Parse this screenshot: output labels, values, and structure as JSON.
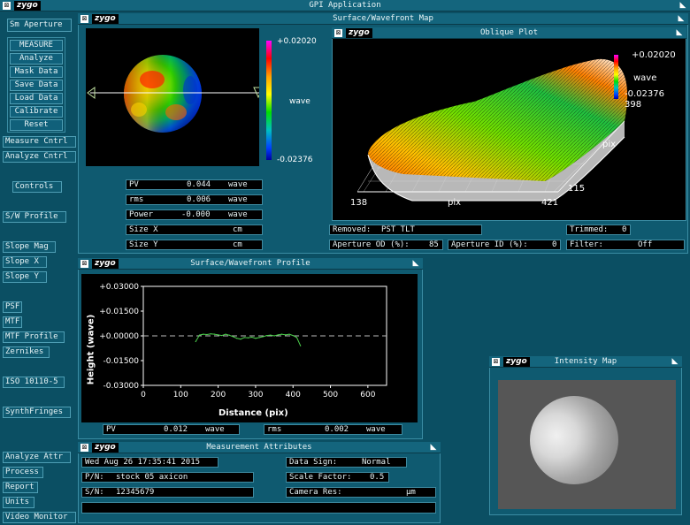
{
  "app": {
    "title": "GPI Application",
    "logo": "zygo"
  },
  "left_menu": {
    "sm_aperture": "Sm Aperture",
    "actions": [
      "MEASURE",
      "Analyze",
      "Mask Data",
      "Save Data",
      "Load Data",
      "Calibrate",
      "Reset"
    ],
    "measure_cntrl": "Measure Cntrl",
    "analyze_cntrl": "Analyze Cntrl",
    "controls": "Controls",
    "sw_profile": "S/W Profile",
    "slope_mag": "Slope Mag",
    "slope_x": "Slope X",
    "slope_y": "Slope Y",
    "psf": "PSF",
    "mtf": "MTF",
    "mtf_profile": "MTF Profile",
    "zernikes": "Zernikes",
    "iso": "ISO 10110-5",
    "synth": "SynthFringes",
    "analyze_attr": "Analyze Attr",
    "process": "Process",
    "report": "Report",
    "units": "Units",
    "video_monitor": "Video Monitor"
  },
  "surface_map": {
    "title": "Surface/Wavefront Map",
    "scale_max": "+0.02020",
    "scale_unit": "wave",
    "scale_min": "-0.02376",
    "stats": {
      "pv": {
        "label": "PV",
        "value": "0.044",
        "unit": "wave"
      },
      "rms": {
        "label": "rms",
        "value": "0.006",
        "unit": "wave"
      },
      "power": {
        "label": "Power",
        "value": "-0.000",
        "unit": "wave"
      },
      "size_x": {
        "label": "Size X",
        "value": "",
        "unit": "cm"
      },
      "size_y": {
        "label": "Size Y",
        "value": "",
        "unit": "cm"
      }
    }
  },
  "oblique": {
    "title": "Oblique Plot",
    "scale_max": "+0.02020",
    "scale_unit": "wave",
    "scale_min": "-0.02376",
    "y_top": "398",
    "y_label": "pix",
    "y_bottom": "115",
    "x_left": "138",
    "x_label": "pix",
    "x_right": "421"
  },
  "info": {
    "removed_label": "Removed:",
    "removed_value": "PST TLT",
    "trimmed_label": "Trimmed:",
    "trimmed_value": "0",
    "aperture_od_label": "Aperture OD (%):",
    "aperture_od_value": "85",
    "aperture_id_label": "Aperture ID (%):",
    "aperture_id_value": "0",
    "filter_label": "Filter:",
    "filter_value": "Off"
  },
  "profile": {
    "title": "Surface/Wavefront Profile",
    "ylabel": "Height (wave)",
    "xlabel": "Distance (pix)",
    "y_ticks": [
      "+0.03000",
      "+0.01500",
      "+0.00000",
      "-0.01500",
      "-0.03000"
    ],
    "x_ticks": [
      "0",
      "100",
      "200",
      "300",
      "400",
      "500",
      "600"
    ],
    "pv": {
      "label": "PV",
      "value": "0.012",
      "unit": "wave"
    },
    "rms": {
      "label": "rms",
      "value": "0.002",
      "unit": "wave"
    }
  },
  "chart_data": {
    "type": "line",
    "title": "Surface/Wavefront Profile",
    "xlabel": "Distance (pix)",
    "ylabel": "Height (wave)",
    "xlim": [
      0,
      650
    ],
    "ylim": [
      -0.03,
      0.03
    ],
    "x": [
      140,
      150,
      160,
      170,
      180,
      190,
      200,
      210,
      220,
      230,
      240,
      250,
      260,
      270,
      280,
      290,
      300,
      310,
      320,
      330,
      340,
      350,
      360,
      370,
      380,
      390,
      400,
      410,
      420
    ],
    "values": [
      -0.0035,
      0.0005,
      0.001,
      0.0008,
      0.0012,
      0.001,
      0.0006,
      0.0002,
      0.001,
      0.0004,
      -0.0005,
      -0.0015,
      -0.002,
      -0.001,
      -0.0012,
      -0.0008,
      -0.0015,
      -0.001,
      -0.0005,
      0.0002,
      0.0005,
      0.0,
      0.0006,
      0.001,
      0.0006,
      0.001,
      0.0002,
      -0.001,
      -0.006
    ]
  },
  "attributes": {
    "title": "Measurement Attributes",
    "date": "Wed Aug 26 17:35:41 2015",
    "pn_label": "P/N:",
    "pn_value": "stock 05 axicon",
    "sn_label": "S/N:",
    "sn_value": "12345679",
    "data_sign_label": "Data Sign:",
    "data_sign_value": "Normal",
    "scale_factor_label": "Scale Factor:",
    "scale_factor_value": "0.5",
    "camera_res_label": "Camera Res:",
    "camera_res_value": "",
    "camera_res_unit": "µm"
  },
  "intensity": {
    "title": "Intensity Map"
  },
  "colors": {
    "background": "#0b4f63",
    "titlebar": "#14657d",
    "profile_line": "#4cd04c"
  }
}
